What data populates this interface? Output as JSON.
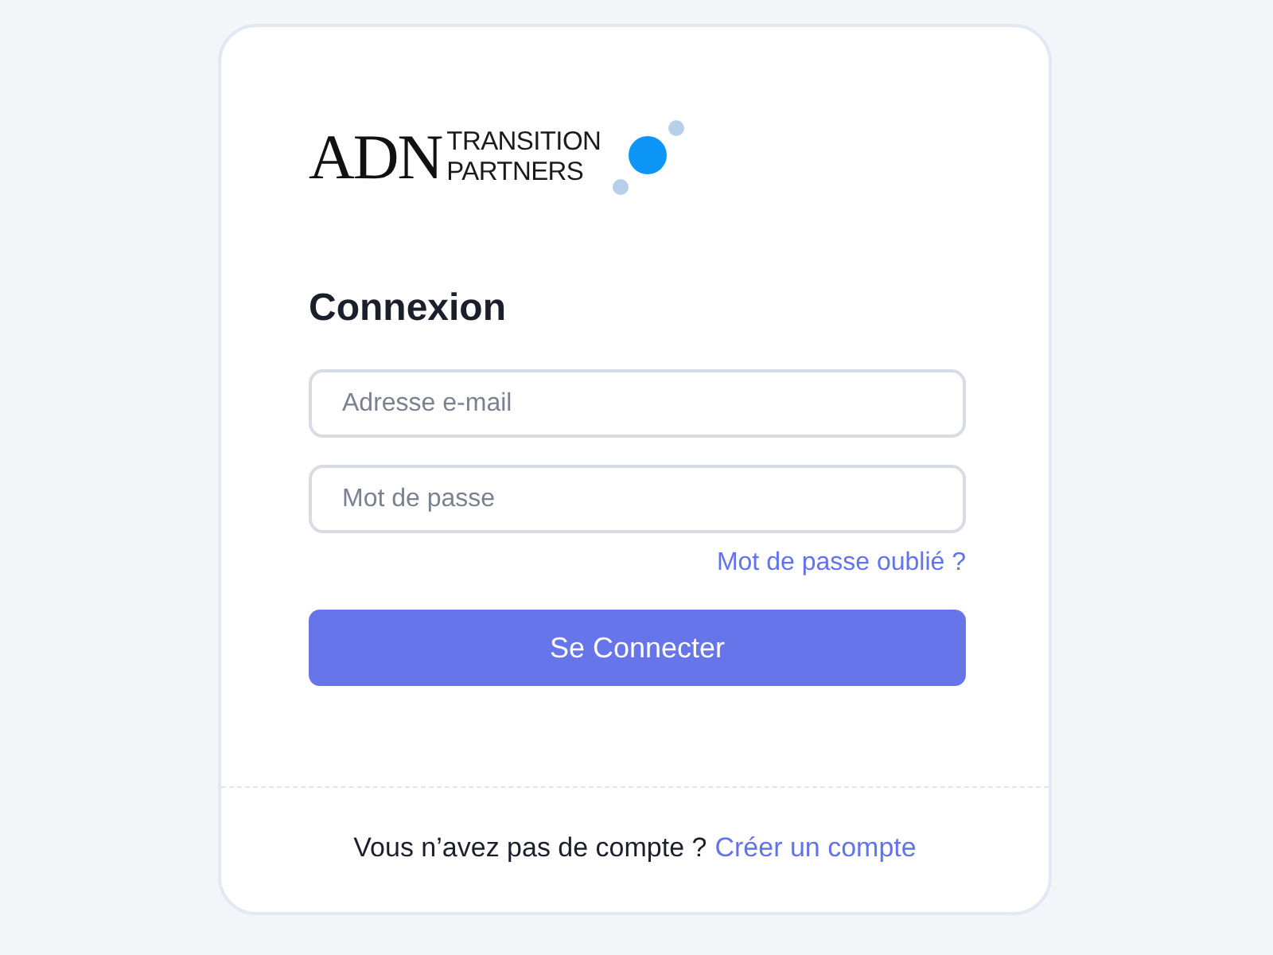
{
  "logo": {
    "mark": "ADN",
    "line_1": "TRANSITION",
    "line_2": "PARTNERS"
  },
  "title": "Connexion",
  "fields": [
    {
      "placeholder": "Adresse e-mail"
    },
    {
      "placeholder": "Mot de passe"
    }
  ],
  "forgot_link": "Mot de passe oublié ?",
  "submit_button": "Se Connecter",
  "footer": {
    "prompt": "Vous n’avez pas de compte ?",
    "link": "Créer un compte"
  }
}
